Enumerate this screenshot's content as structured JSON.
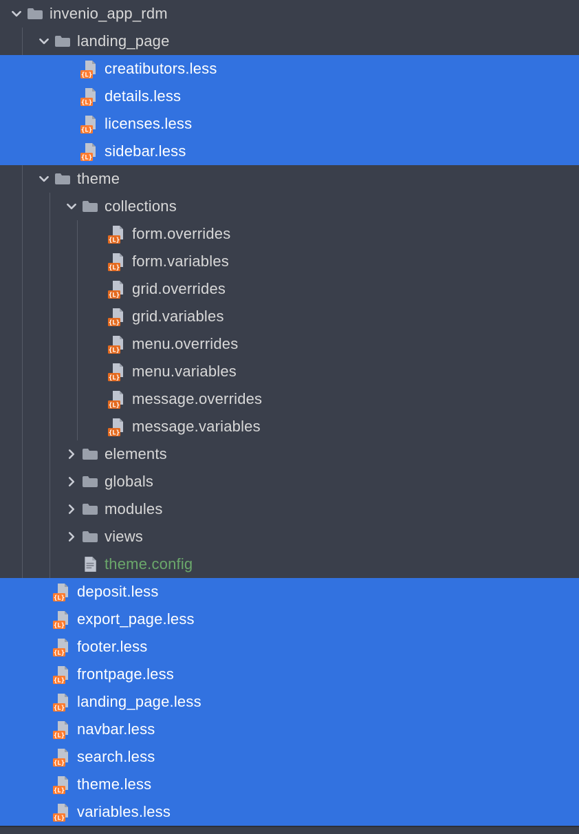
{
  "tree": [
    {
      "depth": 0,
      "type": "folder",
      "arrow": "down",
      "label": "invenio_app_rdm",
      "selected": false
    },
    {
      "depth": 1,
      "type": "folder",
      "arrow": "down",
      "label": "landing_page",
      "selected": false
    },
    {
      "depth": 2,
      "type": "less",
      "arrow": "none",
      "label": "creatibutors.less",
      "selected": true
    },
    {
      "depth": 2,
      "type": "less",
      "arrow": "none",
      "label": "details.less",
      "selected": true
    },
    {
      "depth": 2,
      "type": "less",
      "arrow": "none",
      "label": "licenses.less",
      "selected": true
    },
    {
      "depth": 2,
      "type": "less",
      "arrow": "none",
      "label": "sidebar.less",
      "selected": true
    },
    {
      "depth": 1,
      "type": "folder",
      "arrow": "down",
      "label": "theme",
      "selected": false
    },
    {
      "depth": 2,
      "type": "folder",
      "arrow": "down",
      "label": "collections",
      "selected": false
    },
    {
      "depth": 3,
      "type": "less",
      "arrow": "none",
      "label": "form.overrides",
      "selected": false
    },
    {
      "depth": 3,
      "type": "less",
      "arrow": "none",
      "label": "form.variables",
      "selected": false
    },
    {
      "depth": 3,
      "type": "less",
      "arrow": "none",
      "label": "grid.overrides",
      "selected": false
    },
    {
      "depth": 3,
      "type": "less",
      "arrow": "none",
      "label": "grid.variables",
      "selected": false
    },
    {
      "depth": 3,
      "type": "less",
      "arrow": "none",
      "label": "menu.overrides",
      "selected": false
    },
    {
      "depth": 3,
      "type": "less",
      "arrow": "none",
      "label": "menu.variables",
      "selected": false
    },
    {
      "depth": 3,
      "type": "less",
      "arrow": "none",
      "label": "message.overrides",
      "selected": false
    },
    {
      "depth": 3,
      "type": "less",
      "arrow": "none",
      "label": "message.variables",
      "selected": false
    },
    {
      "depth": 2,
      "type": "folder",
      "arrow": "right",
      "label": "elements",
      "selected": false
    },
    {
      "depth": 2,
      "type": "folder",
      "arrow": "right",
      "label": "globals",
      "selected": false
    },
    {
      "depth": 2,
      "type": "folder",
      "arrow": "right",
      "label": "modules",
      "selected": false
    },
    {
      "depth": 2,
      "type": "folder",
      "arrow": "right",
      "label": "views",
      "selected": false
    },
    {
      "depth": 2,
      "type": "config",
      "arrow": "none",
      "label": "theme.config",
      "selected": false,
      "new": true
    },
    {
      "depth": 1,
      "type": "less",
      "arrow": "none",
      "label": "deposit.less",
      "selected": true
    },
    {
      "depth": 1,
      "type": "less",
      "arrow": "none",
      "label": "export_page.less",
      "selected": true
    },
    {
      "depth": 1,
      "type": "less",
      "arrow": "none",
      "label": "footer.less",
      "selected": true
    },
    {
      "depth": 1,
      "type": "less",
      "arrow": "none",
      "label": "frontpage.less",
      "selected": true
    },
    {
      "depth": 1,
      "type": "less",
      "arrow": "none",
      "label": "landing_page.less",
      "selected": true
    },
    {
      "depth": 1,
      "type": "less",
      "arrow": "none",
      "label": "navbar.less",
      "selected": true
    },
    {
      "depth": 1,
      "type": "less",
      "arrow": "none",
      "label": "search.less",
      "selected": true
    },
    {
      "depth": 1,
      "type": "less",
      "arrow": "none",
      "label": "theme.less",
      "selected": true
    },
    {
      "depth": 1,
      "type": "less",
      "arrow": "none",
      "label": "variables.less",
      "selected": true
    }
  ]
}
